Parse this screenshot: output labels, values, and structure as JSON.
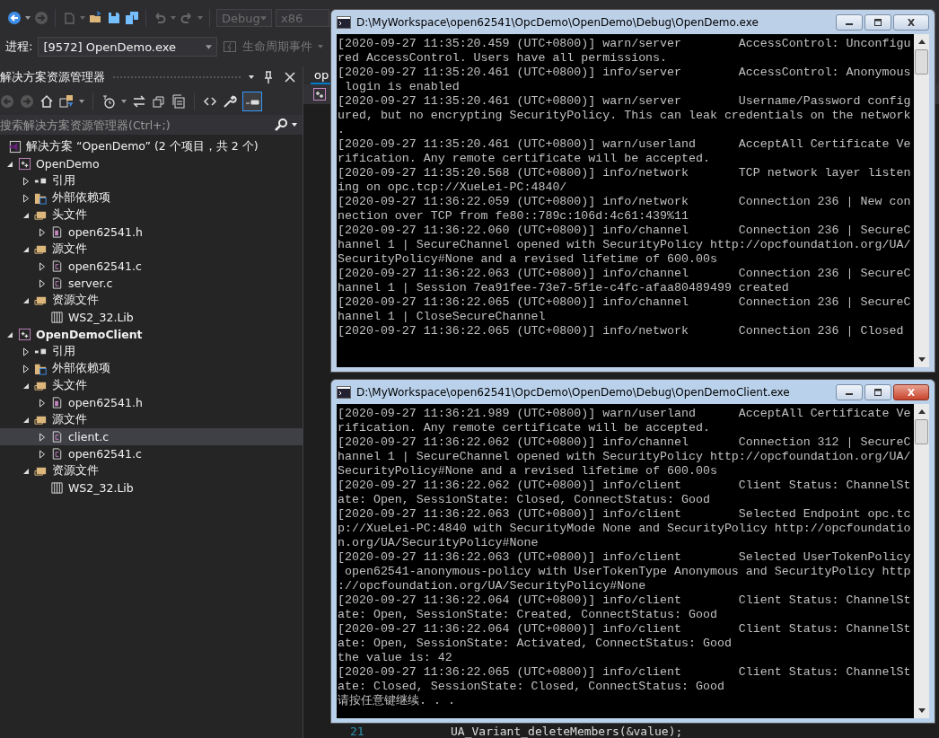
{
  "toolbar": {
    "configuration": "Debug",
    "platform": "x86"
  },
  "debug_bar": {
    "label": "进程:",
    "process": "[9572] OpenDemo.exe",
    "lifecycle": "生命周期事件"
  },
  "solution_explorer": {
    "title": "解决方案资源管理器",
    "preview_toggle_on": true,
    "search": {
      "placeholder": "搜索解决方案资源管理器(Ctrl+;)"
    },
    "tree": [
      {
        "label": "解决方案 “OpenDemo” (2 个项目，共 2 个)",
        "kind": "solution",
        "selected": false,
        "children": [
          {
            "label": "OpenDemo",
            "kind": "project",
            "bold": false,
            "expanded": true,
            "selected": false,
            "children": [
              {
                "label": "引用",
                "kind": "references",
                "expanded": false,
                "selected": false
              },
              {
                "label": "外部依赖项",
                "kind": "external",
                "expanded": false,
                "selected": false
              },
              {
                "label": "头文件",
                "kind": "folder",
                "expanded": true,
                "selected": false,
                "children": [
                  {
                    "label": "open62541.h",
                    "kind": "header",
                    "expanded": false,
                    "selected": false
                  }
                ]
              },
              {
                "label": "源文件",
                "kind": "folder",
                "expanded": true,
                "selected": false,
                "children": [
                  {
                    "label": "open62541.c",
                    "kind": "source",
                    "expanded": false,
                    "selected": false
                  },
                  {
                    "label": "server.c",
                    "kind": "source",
                    "expanded": false,
                    "selected": false
                  }
                ]
              },
              {
                "label": "资源文件",
                "kind": "folder",
                "expanded": true,
                "selected": false,
                "children": [
                  {
                    "label": "WS2_32.Lib",
                    "kind": "lib",
                    "selected": false
                  }
                ]
              }
            ]
          },
          {
            "label": "OpenDemoClient",
            "kind": "project",
            "bold": true,
            "expanded": true,
            "selected": false,
            "children": [
              {
                "label": "引用",
                "kind": "references",
                "expanded": false,
                "selected": false
              },
              {
                "label": "外部依赖项",
                "kind": "external",
                "expanded": false,
                "selected": false
              },
              {
                "label": "头文件",
                "kind": "folder",
                "expanded": true,
                "selected": false,
                "children": [
                  {
                    "label": "open62541.h",
                    "kind": "header",
                    "expanded": false,
                    "selected": false
                  }
                ]
              },
              {
                "label": "源文件",
                "kind": "folder",
                "expanded": true,
                "selected": false,
                "children": [
                  {
                    "label": "client.c",
                    "kind": "source",
                    "expanded": false,
                    "selected": true
                  },
                  {
                    "label": "open62541.c",
                    "kind": "source",
                    "expanded": false,
                    "selected": false
                  }
                ]
              },
              {
                "label": "资源文件",
                "kind": "folder",
                "expanded": true,
                "selected": false,
                "children": [
                  {
                    "label": "WS2_32.Lib",
                    "kind": "lib",
                    "selected": false
                  }
                ]
              }
            ]
          }
        ]
      }
    ]
  },
  "editor": {
    "tab": "op",
    "line_number": "21",
    "code": "UA_Variant_deleteMembers(&value);"
  },
  "consoles": [
    {
      "title": "D:\\MyWorkspace\\open62541\\OpcDemo\\OpenDemo\\Debug\\OpenDemo.exe",
      "active": false,
      "lines": [
        "[2020-09-27 11:35:20.459 (UTC+0800)] warn/server        AccessControl: Unconfigu",
        "red AccessControl. Users have all permissions.",
        "[2020-09-27 11:35:20.461 (UTC+0800)] info/server        AccessControl: Anonymous",
        " login is enabled",
        "[2020-09-27 11:35:20.461 (UTC+0800)] warn/server        Username/Password config",
        "ured, but no encrypting SecurityPolicy. This can leak credentials on the network",
        ".",
        "[2020-09-27 11:35:20.461 (UTC+0800)] warn/userland      AcceptAll Certificate Ve",
        "rification. Any remote certificate will be accepted.",
        "[2020-09-27 11:35:20.568 (UTC+0800)] info/network       TCP network layer listen",
        "ing on opc.tcp://XueLei-PC:4840/",
        "[2020-09-27 11:36:22.059 (UTC+0800)] info/network       Connection 236 | New con",
        "nection over TCP from fe80::789c:106d:4c61:439%11",
        "[2020-09-27 11:36:22.060 (UTC+0800)] info/channel       Connection 236 | SecureC",
        "hannel 1 | SecureChannel opened with SecurityPolicy http://opcfoundation.org/UA/",
        "SecurityPolicy#None and a revised lifetime of 600.00s",
        "[2020-09-27 11:36:22.063 (UTC+0800)] info/channel       Connection 236 | SecureC",
        "hannel 1 | Session 7ea91fee-73e7-5f1e-c4fc-afaa80489499 created",
        "[2020-09-27 11:36:22.065 (UTC+0800)] info/channel       Connection 236 | SecureC",
        "hannel 1 | CloseSecureChannel",
        "[2020-09-27 11:36:22.065 (UTC+0800)] info/network       Connection 236 | Closed"
      ]
    },
    {
      "title": "D:\\MyWorkspace\\open62541\\OpcDemo\\OpenDemo\\Debug\\OpenDemoClient.exe",
      "active": true,
      "lines": [
        "[2020-09-27 11:36:21.989 (UTC+0800)] warn/userland      AcceptAll Certificate Ve",
        "rification. Any remote certificate will be accepted.",
        "[2020-09-27 11:36:22.062 (UTC+0800)] info/channel       Connection 312 | SecureC",
        "hannel 1 | SecureChannel opened with SecurityPolicy http://opcfoundation.org/UA/",
        "SecurityPolicy#None and a revised lifetime of 600.00s",
        "[2020-09-27 11:36:22.062 (UTC+0800)] info/client        Client Status: ChannelSt",
        "ate: Open, SessionState: Closed, ConnectStatus: Good",
        "[2020-09-27 11:36:22.063 (UTC+0800)] info/client        Selected Endpoint opc.tc",
        "p://XueLei-PC:4840 with SecurityMode None and SecurityPolicy http://opcfoundatio",
        "n.org/UA/SecurityPolicy#None",
        "[2020-09-27 11:36:22.063 (UTC+0800)] info/client        Selected UserTokenPolicy",
        " open62541-anonymous-policy with UserTokenType Anonymous and SecurityPolicy http",
        "://opcfoundation.org/UA/SecurityPolicy#None",
        "[2020-09-27 11:36:22.064 (UTC+0800)] info/client        Client Status: ChannelSt",
        "ate: Open, SessionState: Created, ConnectStatus: Good",
        "[2020-09-27 11:36:22.064 (UTC+0800)] info/client        Client Status: ChannelSt",
        "ate: Open, SessionState: Activated, ConnectStatus: Good",
        "the value is: 42",
        "[2020-09-27 11:36:22.065 (UTC+0800)] info/client        Client Status: ChannelSt",
        "ate: Closed, SessionState: Closed, ConnectStatus: Good",
        "请按任意键继续. . ."
      ]
    }
  ]
}
